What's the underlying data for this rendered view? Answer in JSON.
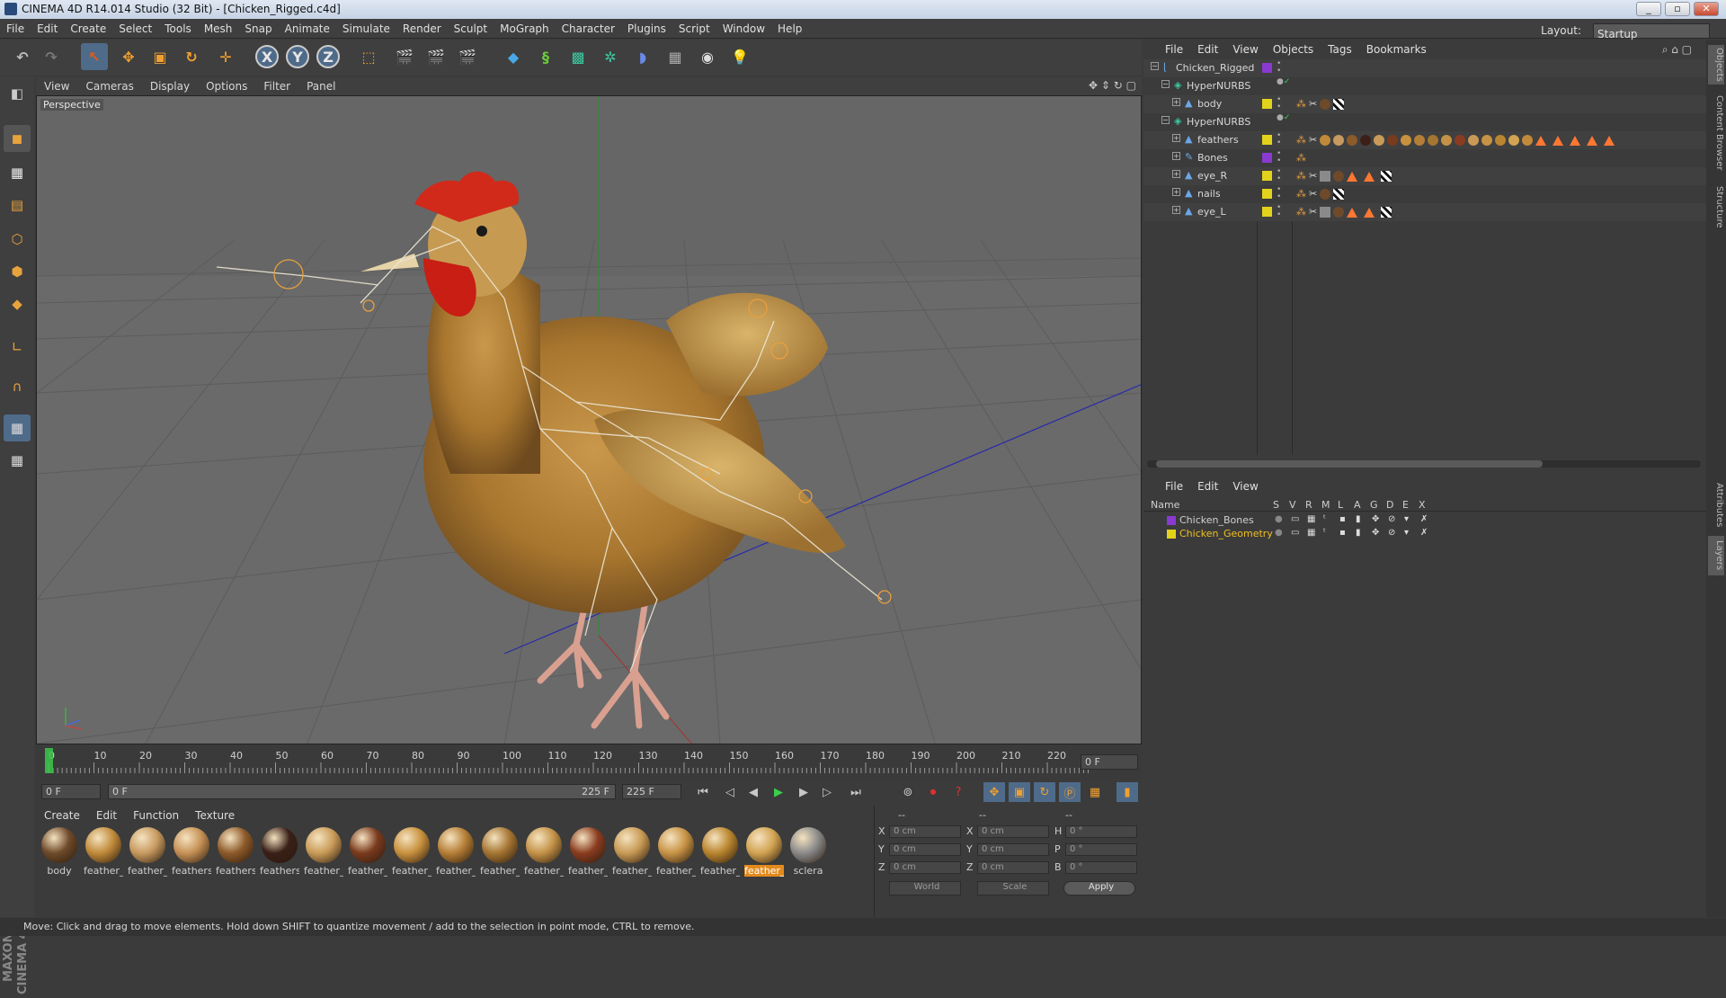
{
  "window": {
    "title": "CINEMA 4D R14.014 Studio (32 Bit) - [Chicken_Rigged.c4d]",
    "buttons": [
      "_",
      "▫",
      "✕"
    ]
  },
  "menubar": [
    "File",
    "Edit",
    "Create",
    "Select",
    "Tools",
    "Mesh",
    "Snap",
    "Animate",
    "Simulate",
    "Render",
    "Sculpt",
    "MoGraph",
    "Character",
    "Plugins",
    "Script",
    "Window",
    "Help"
  ],
  "layout": {
    "label": "Layout:",
    "value": "Startup"
  },
  "toolbar": {
    "x_axis": "X",
    "y_axis": "Y",
    "z_axis": "Z"
  },
  "viewport": {
    "menu": [
      "View",
      "Cameras",
      "Display",
      "Options",
      "Filter",
      "Panel"
    ],
    "label": "Perspective"
  },
  "timeline": {
    "ticks": [
      "0",
      "10",
      "20",
      "30",
      "40",
      "50",
      "60",
      "70",
      "80",
      "90",
      "100",
      "110",
      "120",
      "130",
      "140",
      "150",
      "160",
      "170",
      "180",
      "190",
      "200",
      "210",
      "220"
    ],
    "current_frame": "0 F"
  },
  "transport": {
    "start": "0 F",
    "range_start": "0 F",
    "range_end": "225 F",
    "end": "225 F"
  },
  "materials": {
    "menu": [
      "Create",
      "Edit",
      "Function",
      "Texture"
    ],
    "items": [
      {
        "label": "body",
        "color": "#6e4a2a"
      },
      {
        "label": "feather_",
        "color": "#c08a3a"
      },
      {
        "label": "feather_",
        "color": "#c79a60"
      },
      {
        "label": "feathers",
        "color": "#c69156"
      },
      {
        "label": "feathers",
        "color": "#8d5a2a"
      },
      {
        "label": "feathers",
        "color": "#3a2018"
      },
      {
        "label": "feather_",
        "color": "#c99b58"
      },
      {
        "label": "feather_",
        "color": "#7a3a1e"
      },
      {
        "label": "feather_",
        "color": "#c8913e"
      },
      {
        "label": "feather_",
        "color": "#b57e36"
      },
      {
        "label": "feather_",
        "color": "#a57532"
      },
      {
        "label": "feather_",
        "color": "#c49247"
      },
      {
        "label": "feather_",
        "color": "#8a3c20"
      },
      {
        "label": "feather_",
        "color": "#c89a55"
      },
      {
        "label": "feather_",
        "color": "#c79345"
      },
      {
        "label": "feather_",
        "color": "#b9852e"
      },
      {
        "label": "feather_",
        "color": "#d2a352"
      },
      {
        "label": "sclera",
        "color": "#8a8a8a"
      }
    ],
    "selected_index": 16
  },
  "coordinates": {
    "header": [
      "--",
      "--",
      "--"
    ],
    "rows": [
      {
        "a": "X",
        "av": "0 cm",
        "b": "X",
        "bv": "0 cm",
        "c": "H",
        "cv": "0 °"
      },
      {
        "a": "Y",
        "av": "0 cm",
        "b": "Y",
        "bv": "0 cm",
        "c": "P",
        "cv": "0 °"
      },
      {
        "a": "Z",
        "av": "0 cm",
        "b": "Z",
        "bv": "0 cm",
        "c": "B",
        "cv": "0 °"
      }
    ],
    "mode1": "World",
    "mode2": "Scale",
    "apply": "Apply"
  },
  "status": "Move: Click and drag to move elements. Hold down SHIFT to quantize movement / add to the selection in point mode, CTRL to remove.",
  "objects": {
    "menu": [
      "File",
      "Edit",
      "View",
      "Objects",
      "Tags",
      "Bookmarks"
    ],
    "tree": [
      {
        "name": "Chicken_Rigged",
        "indent": 0,
        "color": "#8a3ad0"
      },
      {
        "name": "HyperNURBS",
        "indent": 1,
        "color": ""
      },
      {
        "name": "body",
        "indent": 2,
        "color": "#e3d21c"
      },
      {
        "name": "HyperNURBS",
        "indent": 1,
        "color": ""
      },
      {
        "name": "feathers",
        "indent": 2,
        "color": "#e3d21c"
      },
      {
        "name": "Bones",
        "indent": 2,
        "color": "#8a3ad0"
      },
      {
        "name": "eye_R",
        "indent": 2,
        "color": "#e3d21c"
      },
      {
        "name": "nails",
        "indent": 2,
        "color": "#e3d21c"
      },
      {
        "name": "eye_L",
        "indent": 2,
        "color": "#e3d21c"
      }
    ]
  },
  "layers": {
    "menu": [
      "File",
      "Edit",
      "View"
    ],
    "columns": [
      "Name",
      "S",
      "V",
      "R",
      "M",
      "L",
      "A",
      "G",
      "D",
      "E",
      "X"
    ],
    "rows": [
      {
        "name": "Chicken_Bones",
        "color": "#8a3ad0",
        "text_color": "#d0d0d0"
      },
      {
        "name": "Chicken_Geometry",
        "color": "#e3d21c",
        "text_color": "#f0c020"
      }
    ]
  },
  "side_tabs": [
    "Objects",
    "Content Browser",
    "Structure",
    "Attributes",
    "Layers"
  ]
}
